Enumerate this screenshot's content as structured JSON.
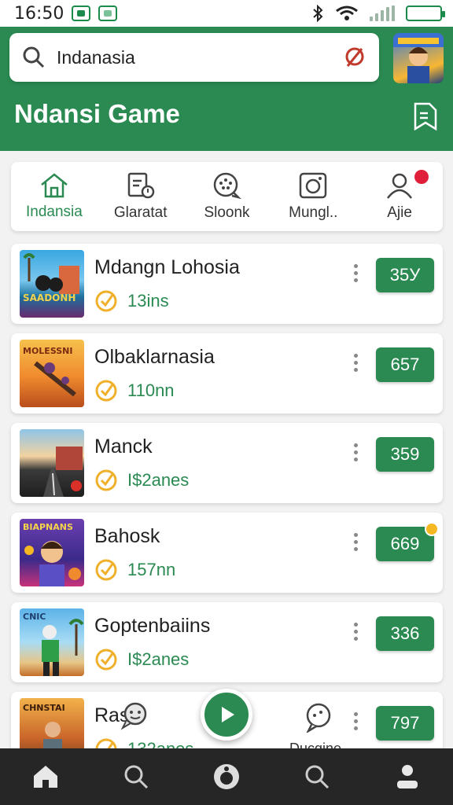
{
  "status": {
    "time": "16:50"
  },
  "header": {
    "search_value": "Indanasia",
    "title": "Ndansi Game"
  },
  "tabs": [
    {
      "label": "Indansia",
      "icon": "home-icon",
      "active": true
    },
    {
      "label": "Glaratat",
      "icon": "calendar-clock-icon"
    },
    {
      "label": "Sloonk",
      "icon": "chat-dots-icon"
    },
    {
      "label": "Mungl..",
      "icon": "camera-icon"
    },
    {
      "label": "Ajie",
      "icon": "user-icon",
      "badge": true
    }
  ],
  "games": [
    {
      "title": "Mdangn Lohosia",
      "meta": "13ins",
      "score": "35У",
      "thumb_text": "SAADONH"
    },
    {
      "title": "Olbaklarnasia",
      "meta": "110nn",
      "score": "657",
      "thumb_text": "MOLESSNI"
    },
    {
      "title": "Manck",
      "meta": "I$2anes",
      "score": "359",
      "thumb_text": ""
    },
    {
      "title": "Bahosk",
      "meta": "157nn",
      "score": "669",
      "thumb_text": "BIAPNANS"
    },
    {
      "title": "Goptenbaiins",
      "meta": "I$2anes",
      "score": "336",
      "thumb_text": "CNIC"
    },
    {
      "title": "Ras",
      "meta": "132anes",
      "score": "797",
      "thumb_text": "CHNSTAI"
    }
  ],
  "overlay": {
    "label": "Ducgine"
  },
  "colors": {
    "brand": "#2a8a52",
    "accent": "#f5b722",
    "badge": "#e0203a"
  },
  "bottom_nav": [
    "home-icon",
    "search-icon",
    "record-icon",
    "search-icon",
    "profile-icon"
  ]
}
